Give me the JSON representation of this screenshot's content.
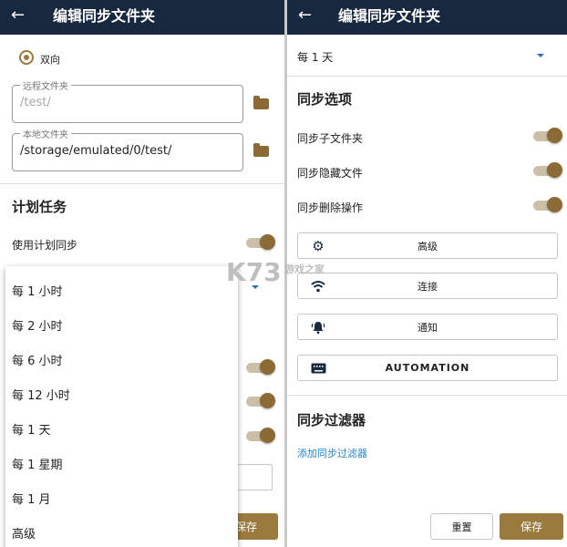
{
  "left": {
    "title": "编辑同步文件夹",
    "direction": {
      "label": "双向"
    },
    "remote_folder": {
      "label": "远程文件夹",
      "value": "/test/"
    },
    "local_folder": {
      "label": "本地文件夹",
      "value": "/storage/emulated/0/test/"
    },
    "schedule_section": "计划任务",
    "use_schedule_label": "使用计划同步",
    "save_label": "保存",
    "menu": {
      "items": [
        "每 1 小时",
        "每 2 小时",
        "每 6 小时",
        "每 12 小时",
        "每 1 天",
        "每 1 星期",
        "每 1 月",
        "高级"
      ]
    }
  },
  "right": {
    "title": "编辑同步文件夹",
    "interval_value": "每 1 天",
    "sync_options_title": "同步选项",
    "options": [
      "同步子文件夹",
      "同步隐藏文件",
      "同步删除操作"
    ],
    "buttons": {
      "advanced": "高级",
      "connection": "连接",
      "notification": "通知",
      "automation": "AUTOMATION"
    },
    "filters_title": "同步过滤器",
    "add_filter_link": "添加同步过滤器",
    "reset_label": "重置",
    "save_label": "保存"
  },
  "watermark": {
    "text": "K73",
    "subtitle": "游戏之家"
  },
  "colors": {
    "appbar": "#17283f",
    "accent": "#9b7a3d",
    "link": "#2b86c9"
  }
}
